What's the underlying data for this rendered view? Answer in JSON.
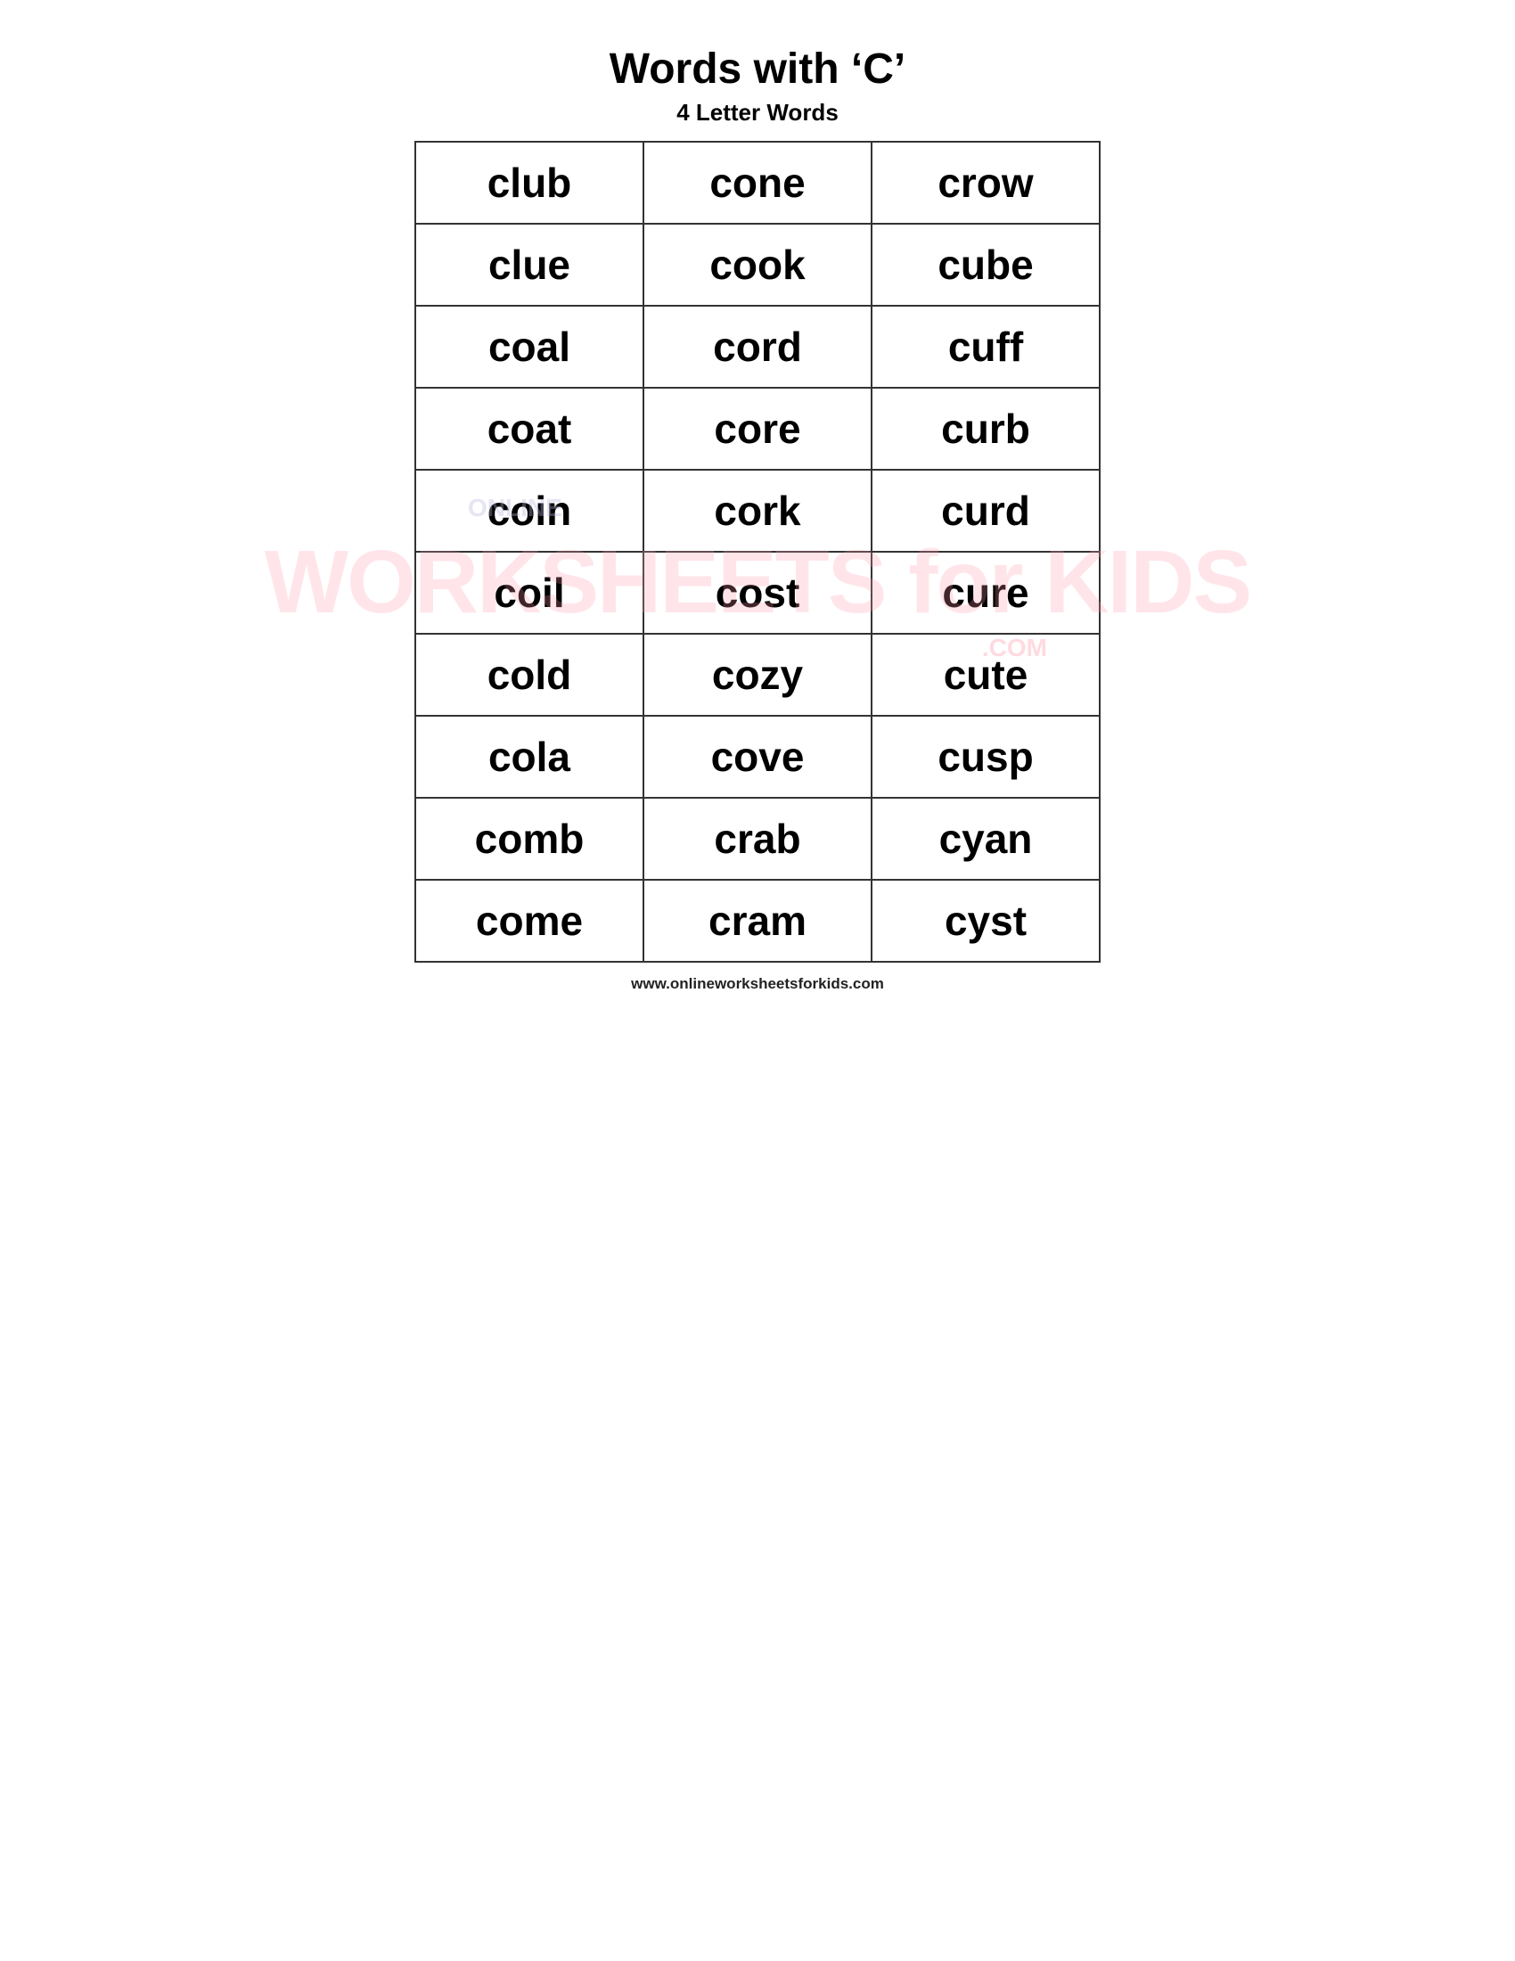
{
  "page": {
    "title": "Words with ‘C’",
    "subtitle": "4 Letter Words",
    "footer": "www.onlineworksheetsforkids.com",
    "watermark": "WORKSHEETS for KIDS",
    "watermark_com": ".COM",
    "watermark_online": "ONLINE",
    "rows": [
      [
        "club",
        "cone",
        "crow"
      ],
      [
        "clue",
        "cook",
        "cube"
      ],
      [
        "coal",
        "cord",
        "cuff"
      ],
      [
        "coat",
        "core",
        "curb"
      ],
      [
        "coin",
        "cork",
        "curd"
      ],
      [
        "coil",
        "cost",
        "cure"
      ],
      [
        "cold",
        "cozy",
        "cute"
      ],
      [
        "cola",
        "cove",
        "cusp"
      ],
      [
        "comb",
        "crab",
        "cyan"
      ],
      [
        "come",
        "cram",
        "cyst"
      ]
    ]
  }
}
